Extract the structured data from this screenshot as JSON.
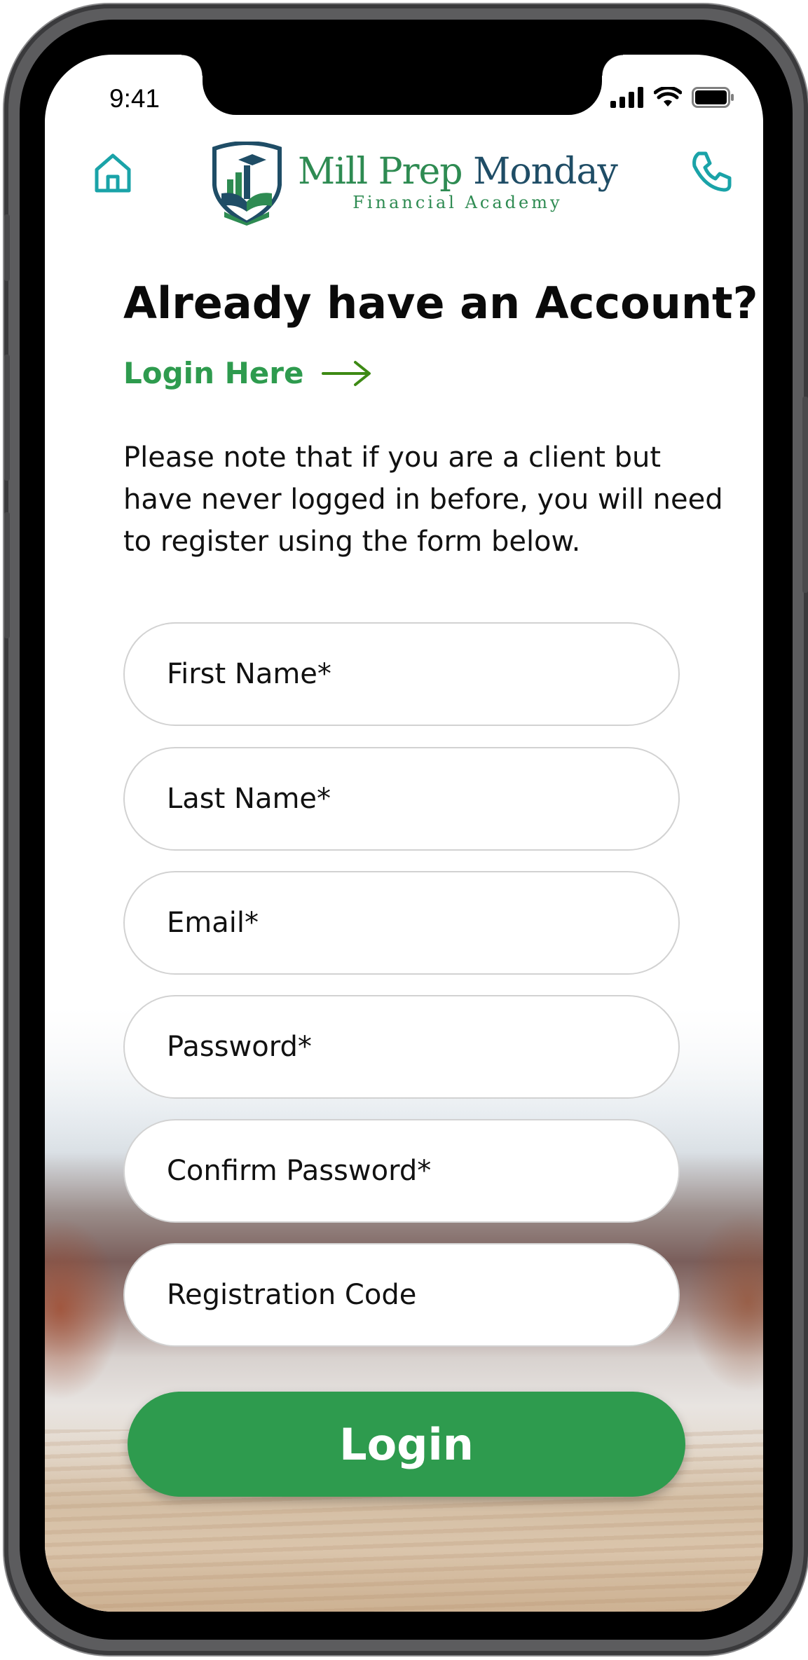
{
  "status_bar": {
    "time": "9:41"
  },
  "header": {
    "brand_name_part1": "Mill Prep ",
    "brand_name_part2": "Monday",
    "brand_tagline": "Financial Academy",
    "home_icon": "home-icon",
    "phone_icon": "phone-icon"
  },
  "headline": "Already have an Account?",
  "login_link": {
    "label": "Login Here",
    "icon": "arrow-right-icon"
  },
  "note": "Please note that if you are a client but have never logged in before, you will need to register using the form below.",
  "form": {
    "fields": [
      {
        "placeholder": "First Name*",
        "value": ""
      },
      {
        "placeholder": "Last Name*",
        "value": ""
      },
      {
        "placeholder": "Email*",
        "value": ""
      },
      {
        "placeholder": "Password*",
        "value": ""
      },
      {
        "placeholder": "Confirm Password*",
        "value": ""
      },
      {
        "placeholder": "Registration Code",
        "value": ""
      }
    ],
    "submit_label": "Login"
  },
  "colors": {
    "accent_green": "#2e9b4e",
    "icon_teal": "#1aa3a8",
    "brand_navy": "#1f4d66"
  }
}
